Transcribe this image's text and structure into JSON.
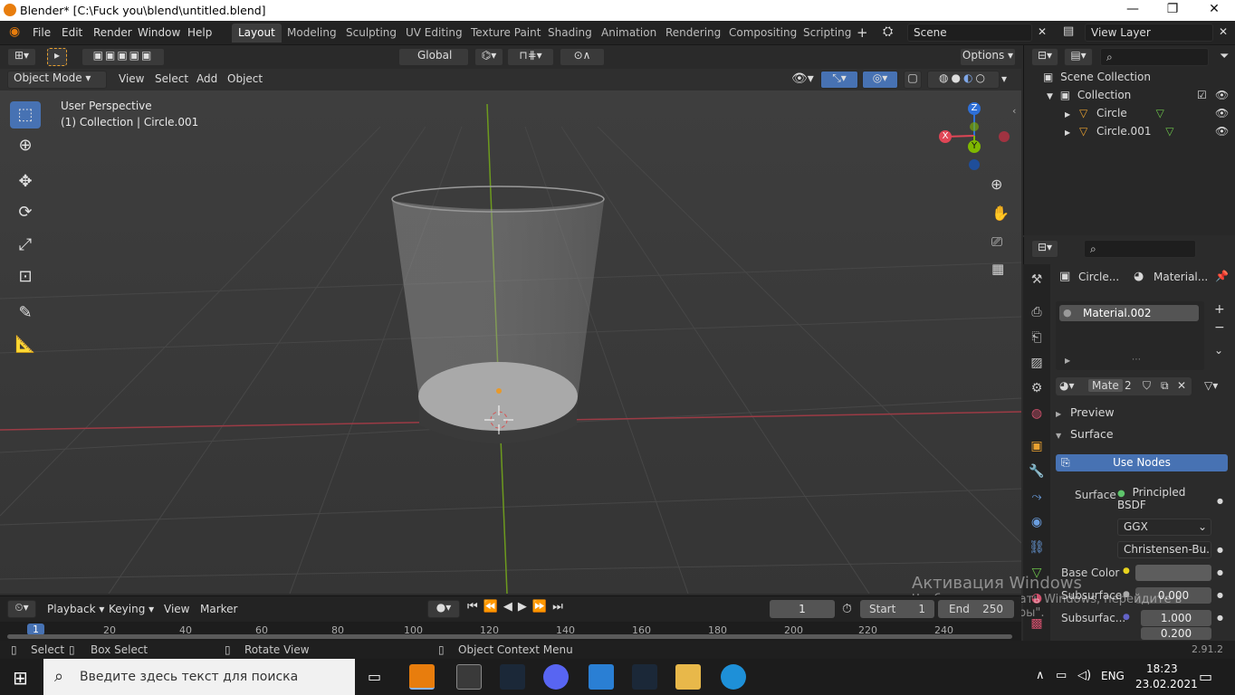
{
  "window": {
    "title": "Blender* [C:\\Fuck you\\blend\\untitled.blend]",
    "minimize": "—",
    "maximize": "❐",
    "close": "✕"
  },
  "menu": {
    "items": [
      "File",
      "Edit",
      "Render",
      "Window",
      "Help"
    ]
  },
  "workspaces": [
    "Layout",
    "Modeling",
    "Sculpting",
    "UV Editing",
    "Texture Paint",
    "Shading",
    "Animation",
    "Rendering",
    "Compositing",
    "Scripting"
  ],
  "scene": {
    "label": "Scene",
    "view_layer": "View Layer"
  },
  "tool_header": {
    "orientation": "Global",
    "options": "Options"
  },
  "viewport_header": {
    "mode": "Object Mode",
    "menus": [
      "View",
      "Select",
      "Add",
      "Object"
    ]
  },
  "viewport": {
    "perspective": "User Perspective",
    "collection_info": "(1) Collection | Circle.001",
    "axis_x": "X",
    "axis_y": "Y",
    "axis_z": "Z"
  },
  "outliner": {
    "root": "Scene Collection",
    "collection": "Collection",
    "objects": [
      "Circle",
      "Circle.001"
    ]
  },
  "properties": {
    "breadcrumb_object": "Circle...",
    "breadcrumb_material": "Material...",
    "material_slot": "Material.002",
    "material_name": "Mate",
    "users": "2",
    "preview": "Preview",
    "surface_section": "Surface",
    "use_nodes": "Use Nodes",
    "surface_label": "Surface",
    "surface_value": "Principled BSDF",
    "distribution": "GGX",
    "subsurface_method": "Christensen-Bu...",
    "base_color_label": "Base Color",
    "subsurface_label": "Subsurface",
    "subsurface_value": "0.000",
    "subsurface_radius_label": "Subsurfac...",
    "subsurface_radius_1": "1.000",
    "subsurface_radius_2": "0.200"
  },
  "timeline": {
    "menus": [
      "Playback",
      "Keying",
      "View",
      "Marker"
    ],
    "current_frame": "1",
    "start_label": "Start",
    "start": "1",
    "end_label": "End",
    "end": "250",
    "ruler": [
      "1",
      "20",
      "40",
      "60",
      "80",
      "100",
      "120",
      "140",
      "160",
      "180",
      "200",
      "220",
      "240"
    ]
  },
  "statusbar": {
    "select": "Select",
    "box_select": "Box Select",
    "rotate": "Rotate View",
    "context": "Object Context Menu",
    "version": "2.91.2"
  },
  "watermark": {
    "line1": "Активация Windows",
    "line2": "Чтобы активировать Windows, перейдите в",
    "line3": "раздел \"Параметры\"."
  },
  "taskbar": {
    "search_placeholder": "Введите здесь текст для поиска",
    "lang": "ENG",
    "time": "18:23",
    "date": "23.02.2021"
  },
  "colors": {
    "accent": "#4772b3",
    "blender_orange": "#e87d0d",
    "axis_x": "#e04656",
    "axis_y": "#7fb800",
    "axis_z": "#2e6fd6"
  }
}
